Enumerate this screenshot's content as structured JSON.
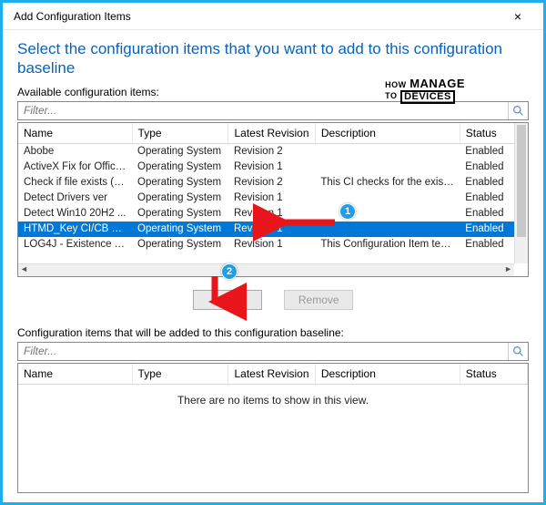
{
  "window": {
    "title": "Add Configuration Items",
    "close": "×"
  },
  "instruction": "Select the configuration items that you want to add to this configuration baseline",
  "available": {
    "label": "Available configuration items:",
    "filter_placeholder": "Filter...",
    "columns": {
      "name": "Name",
      "type": "Type",
      "latest_revision": "Latest Revision",
      "description": "Description",
      "status": "Status"
    },
    "rows": [
      {
        "name": "Abobe",
        "type": "Operating System",
        "latest_revision": "Revision 2",
        "description": "",
        "status": "Enabled",
        "selected": false
      },
      {
        "name": "ActiveX Fix for Office ...",
        "type": "Operating System",
        "latest_revision": "Revision 1",
        "description": "",
        "status": "Enabled",
        "selected": false
      },
      {
        "name": "Check if file exists (Lo...",
        "type": "Operating System",
        "latest_revision": "Revision 2",
        "description": "This CI checks for the exist...",
        "status": "Enabled",
        "selected": false
      },
      {
        "name": "Detect Drivers ver",
        "type": "Operating System",
        "latest_revision": "Revision 1",
        "description": "",
        "status": "Enabled",
        "selected": false
      },
      {
        "name": "Detect Win10 20H2 ...",
        "type": "Operating System",
        "latest_revision": "Revision 1",
        "description": "",
        "status": "Enabled",
        "selected": false
      },
      {
        "name": "HTMD_Key CI/CB R...",
        "type": "Operating System",
        "latest_revision": "Revision 1",
        "description": "",
        "status": "Enabled",
        "selected": true
      },
      {
        "name": "LOG4J - Existence Test",
        "type": "Operating System",
        "latest_revision": "Revision 1",
        "description": "This Configuration Item test...",
        "status": "Enabled",
        "selected": false
      }
    ]
  },
  "buttons": {
    "add": "Add",
    "remove": "Remove"
  },
  "selected_list": {
    "label": "Configuration items that will be added to this configuration baseline:",
    "filter_placeholder": "Filter...",
    "columns": {
      "name": "Name",
      "type": "Type",
      "latest_revision": "Latest Revision",
      "description": "Description",
      "status": "Status"
    },
    "empty": "There are no items to show in this view."
  },
  "annotations": {
    "step1": "1",
    "step2": "2"
  },
  "watermark": {
    "line1": "HOW MANAGE",
    "line2": "DEVICES",
    "to": "TO"
  }
}
